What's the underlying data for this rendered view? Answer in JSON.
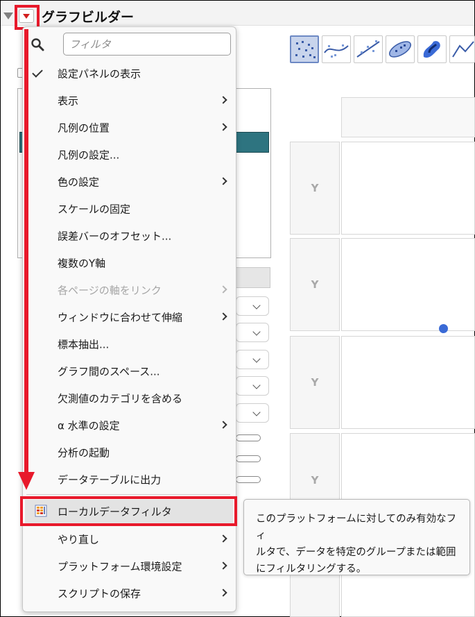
{
  "window": {
    "title": "グラフビルダー"
  },
  "search": {
    "placeholder": "フィルタ"
  },
  "menu": {
    "items": [
      {
        "label": "設定パネルの表示",
        "checked": true,
        "submenu": false,
        "disabled": false
      },
      {
        "label": "表示",
        "checked": false,
        "submenu": true,
        "disabled": false
      },
      {
        "label": "凡例の位置",
        "checked": false,
        "submenu": true,
        "disabled": false
      },
      {
        "label": "凡例の設定...",
        "checked": false,
        "submenu": false,
        "disabled": false
      },
      {
        "label": "色の設定",
        "checked": false,
        "submenu": true,
        "disabled": false
      },
      {
        "label": "スケールの固定",
        "checked": false,
        "submenu": false,
        "disabled": false
      },
      {
        "label": "誤差バーのオフセット...",
        "checked": false,
        "submenu": false,
        "disabled": false
      },
      {
        "label": "複数のY軸",
        "checked": false,
        "submenu": false,
        "disabled": false
      },
      {
        "label": "各ページの軸をリンク",
        "checked": false,
        "submenu": true,
        "disabled": true
      },
      {
        "label": "ウィンドウに合わせて伸縮",
        "checked": false,
        "submenu": true,
        "disabled": false
      },
      {
        "label": "標本抽出...",
        "checked": false,
        "submenu": false,
        "disabled": false
      },
      {
        "label": "グラフ間のスペース...",
        "checked": false,
        "submenu": false,
        "disabled": false
      },
      {
        "label": "欠測値のカテゴリを含める",
        "checked": false,
        "submenu": false,
        "disabled": false
      },
      {
        "label": "α 水準の設定",
        "checked": false,
        "submenu": true,
        "disabled": false
      },
      {
        "label": "分析の起動",
        "checked": false,
        "submenu": false,
        "disabled": false
      },
      {
        "label": "データテーブルに出力",
        "checked": false,
        "submenu": false,
        "disabled": false
      },
      {
        "label": "ローカルデータフィルタ",
        "checked": false,
        "submenu": false,
        "disabled": false,
        "highlighted": true
      },
      {
        "label": "やり直し",
        "checked": false,
        "submenu": true,
        "disabled": false
      },
      {
        "label": "プラットフォーム環境設定",
        "checked": false,
        "submenu": true,
        "disabled": false
      },
      {
        "label": "スクリプトの保存",
        "checked": false,
        "submenu": true,
        "disabled": false
      }
    ]
  },
  "tooltip": {
    "lines": [
      "このプラットフォームに対してのみ有効なフィ",
      "ルタで、データを特定のグループまたは範囲",
      "にフィルタリングする。"
    ]
  },
  "graph": {
    "y_labels": [
      "Y",
      "Y",
      "Y",
      "Y"
    ]
  },
  "colors": {
    "annotation_red": "#e8192b",
    "selected_variable": "#2e7480",
    "point": "#3a6ad6"
  }
}
